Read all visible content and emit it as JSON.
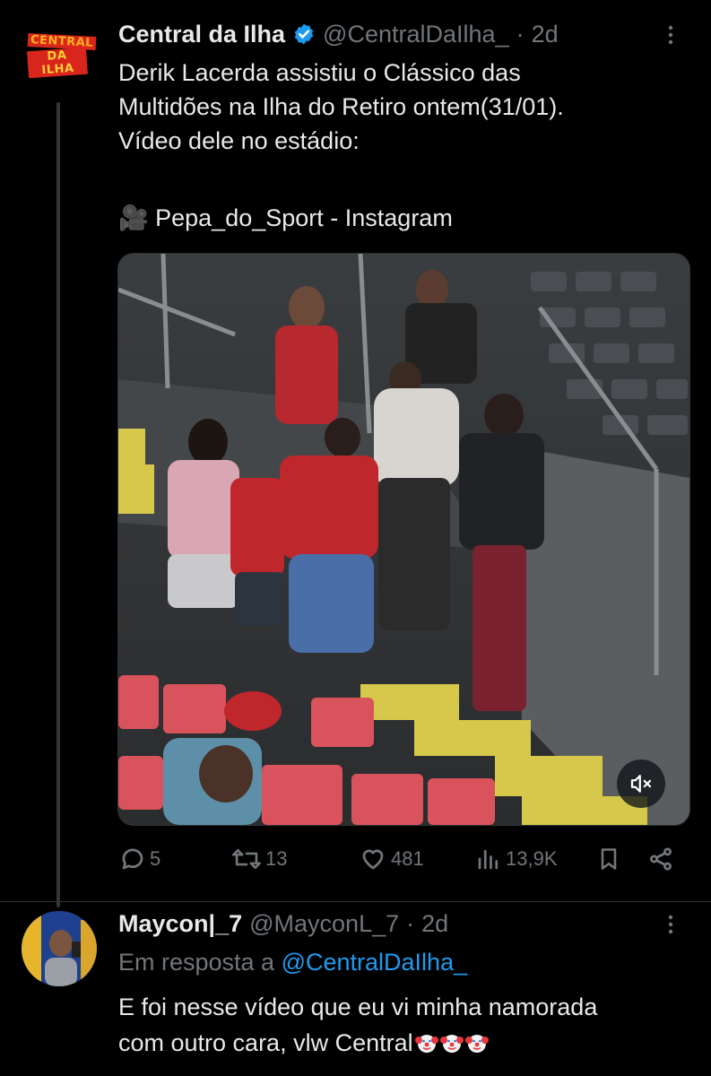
{
  "tweet": {
    "author_name": "Central da Ilha",
    "author_handle": "@CentralDaIlha_",
    "separator": "·",
    "time": "2d",
    "logo_line1": "CENTRAL",
    "logo_line2": "DA ILHA",
    "text_lines": [
      "Derik Lacerda assistiu o Clássico das",
      "Multidões na Ilha do Retiro ontem(31/01).",
      "Vídeo dele no estádio:",
      "",
      "🎥 Pepa_do_Sport - Instagram"
    ],
    "stats": {
      "replies": "5",
      "retweets": "13",
      "likes": "481",
      "views": "13,9K"
    }
  },
  "reply": {
    "author_name": "Maycon|_7",
    "author_handle": "@MayconL_7",
    "separator": "·",
    "time": "2d",
    "reply_prefix": "Em resposta a",
    "reply_target": "@CentralDaIlha_",
    "text_line1": "E foi nesse vídeo que eu vi minha namorada",
    "text_line2": "com outro cara, vlw Central"
  },
  "colors": {
    "background": "#000000",
    "text_primary": "#e7e9ea",
    "text_secondary": "#71767b",
    "link": "#1d9bf0",
    "verified_badge": "#1d9bf0",
    "divider": "#2f3336"
  },
  "icons": [
    "more-dots-icon",
    "verified-badge-icon",
    "reply-icon",
    "retweet-icon",
    "like-icon",
    "views-icon",
    "bookmark-icon",
    "share-icon",
    "mute-icon",
    "clown-emoji-icon"
  ]
}
